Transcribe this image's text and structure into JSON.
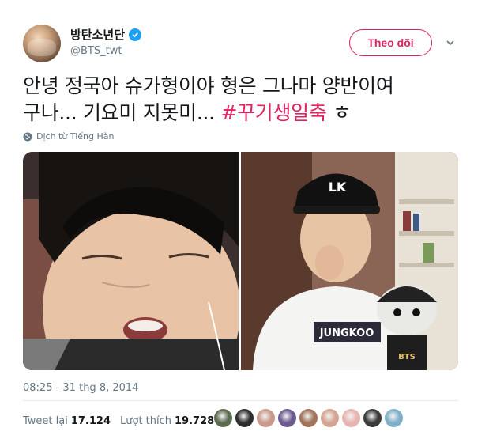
{
  "tweet": {
    "display_name": "방탄소년단",
    "handle": "@BTS_twt",
    "follow_label": "Theo dõi",
    "text_line1": "안녕 정국아 슈가형이야 형은 그나마 양반이여",
    "text_line2_plain": "구나... 기요미 지못미... ",
    "hashtag": "#꾸기생일축",
    "text_tail": " ㅎ",
    "translate_label": "Dịch từ Tiếng Hàn",
    "timestamp": "08:25 - 31 thg 8, 2014",
    "retweet_label": "Tweet lại",
    "retweet_count": "17.124",
    "like_label": "Lượt thích",
    "like_count": "19.728"
  },
  "photos": {
    "cap_text": "LK",
    "shirt_text": "JUNGKOO",
    "plush_text": "BTS"
  },
  "colors": {
    "accent": "#e0245e",
    "verified": "#1da1f2",
    "muted": "#657786"
  },
  "icons": [
    "verified-icon",
    "chevron-down-icon",
    "globe-icon"
  ],
  "liker_avatar_colors": [
    "#5c6a4e",
    "#2d2d2d",
    "#c89a8a",
    "#6a5a8e",
    "#a0735a",
    "#d4a492",
    "#e8b4b0",
    "#3a3a3a",
    "#7fb0c8"
  ]
}
